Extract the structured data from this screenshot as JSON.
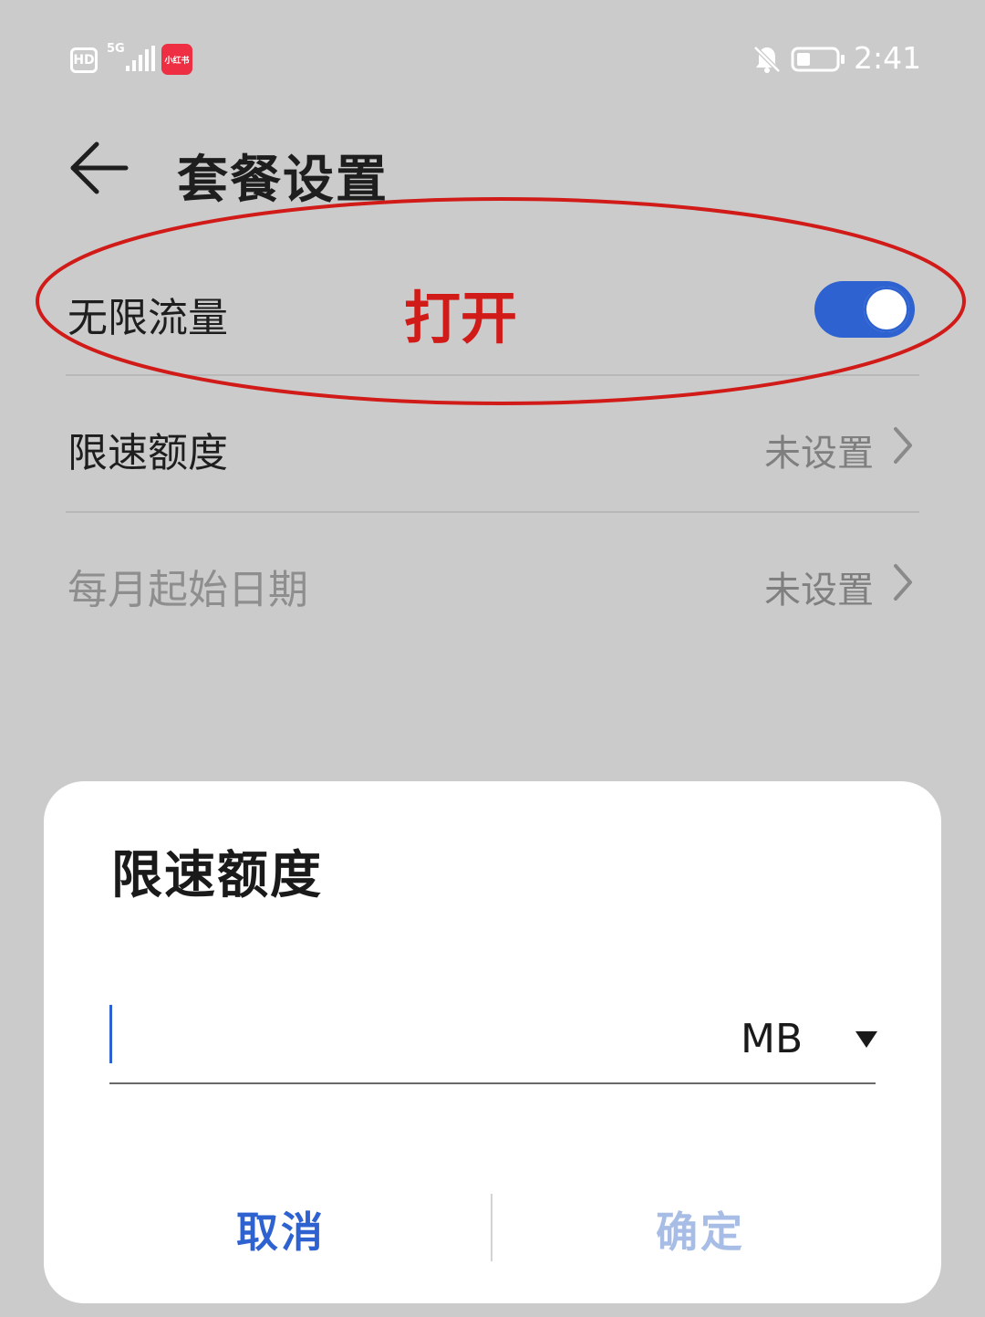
{
  "status_bar": {
    "hd_label": "HD",
    "network_label": "5G",
    "app_badge_label": "小红书",
    "time": "2:41",
    "icons": [
      "hd-icon",
      "signal-icon",
      "app-icon",
      "mute-bell-icon",
      "battery-icon"
    ]
  },
  "header": {
    "back_icon": "back-arrow-icon",
    "title": "套餐设置"
  },
  "settings": {
    "unlimited_data": {
      "label": "无限流量",
      "toggle_on": true
    },
    "speed_limit": {
      "label": "限速额度",
      "value": "未设置"
    },
    "monthly_start": {
      "label": "每月起始日期",
      "value": "未设置"
    }
  },
  "annotation": {
    "text": "打开",
    "color": "#d11b18"
  },
  "dialog": {
    "title": "限速额度",
    "input_value": "",
    "unit": "MB",
    "cancel_label": "取消",
    "confirm_label": "确定"
  },
  "colors": {
    "accent": "#2d62d0",
    "accent_disabled": "#a7bde6",
    "background_dimmed": "#cbcbcb",
    "annotation_red": "#d11b18"
  }
}
